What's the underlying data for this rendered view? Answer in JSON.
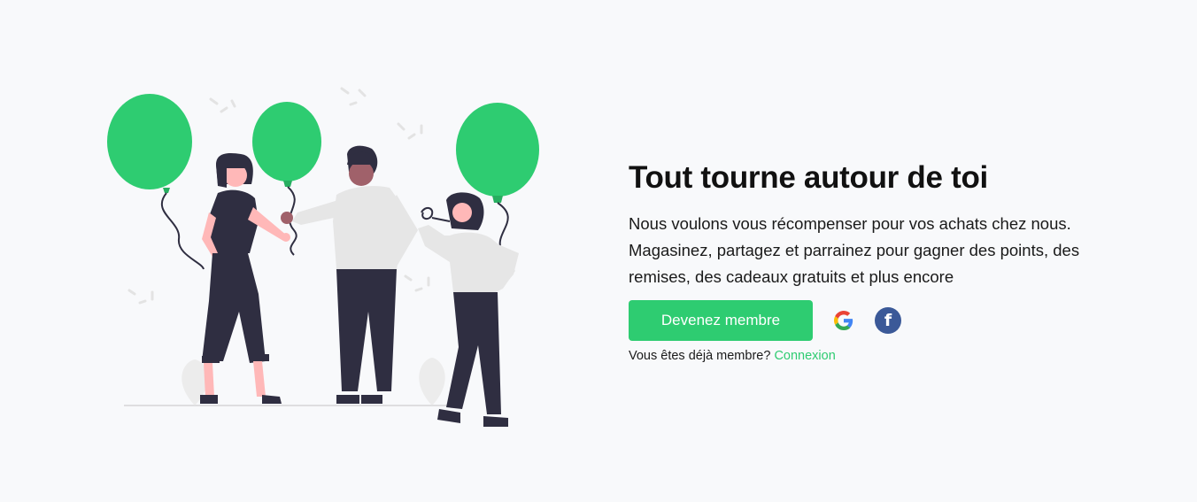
{
  "hero": {
    "title": "Tout tourne autour de toi",
    "description": "Nous voulons vous récompenser pour vos achats chez nous. Magasinez, partagez et parrainez pour gagner des points, des remises, des cadeaux gratuits et plus encore",
    "join_button_label": "Devenez membre",
    "already_member_text": "Vous êtes déjà membre?",
    "login_link_label": "Connexion",
    "social": {
      "google_icon": "google-icon",
      "facebook_icon": "facebook-icon",
      "facebook_glyph": "f"
    }
  },
  "colors": {
    "accent": "#2ecc71",
    "facebook": "#3b5998",
    "background": "#f8f9fb",
    "text": "#111111"
  }
}
